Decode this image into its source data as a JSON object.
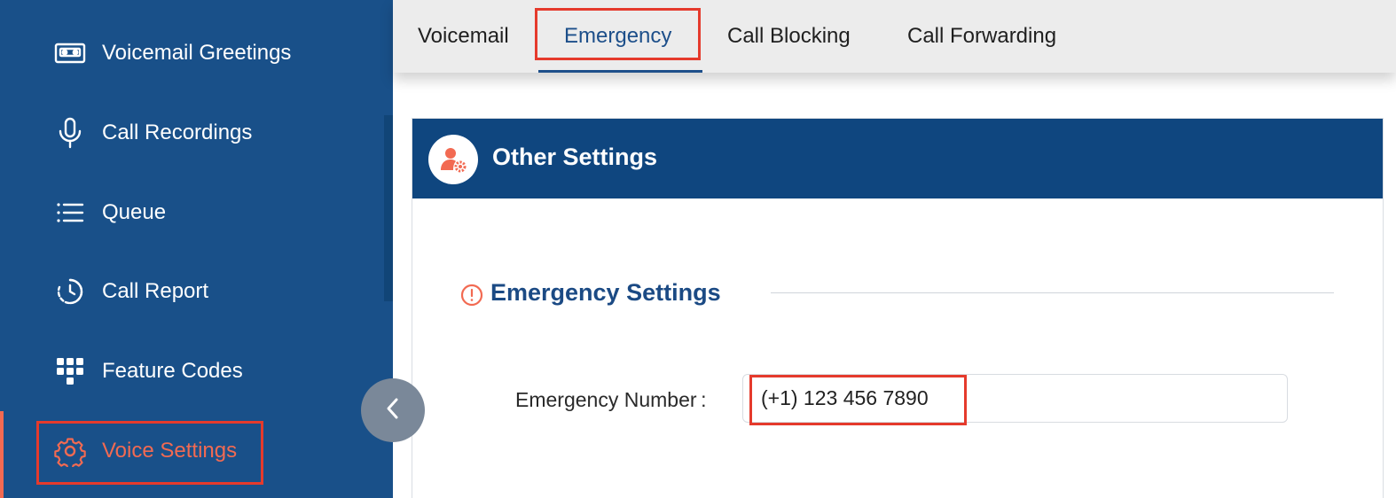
{
  "sidebar": {
    "items": [
      {
        "label": "Voicemail Greetings",
        "icon": "cassette-icon"
      },
      {
        "label": "Call Recordings",
        "icon": "microphone-icon"
      },
      {
        "label": "Queue",
        "icon": "list-icon"
      },
      {
        "label": "Call Report",
        "icon": "clock-history-icon"
      },
      {
        "label": "Feature Codes",
        "icon": "keypad-icon"
      },
      {
        "label": "Voice Settings",
        "icon": "gear-icon",
        "active": true
      }
    ]
  },
  "tabs": [
    {
      "label": "Voicemail"
    },
    {
      "label": "Emergency",
      "active": true
    },
    {
      "label": "Call Blocking"
    },
    {
      "label": "Call Forwarding"
    }
  ],
  "card": {
    "title": "Other Settings",
    "icon": "user-settings-icon"
  },
  "section": {
    "title": "Emergency Settings",
    "icon": "alert-circle-icon"
  },
  "emergency_number": {
    "label": "Emergency Number :",
    "value": "(+1) 123 456 7890"
  },
  "colors": {
    "sidebar_bg": "#195089",
    "header_bg": "#0f467f",
    "accent": "#f26a52",
    "highlight": "#e53a2c",
    "tab_active": "#1d4f8a"
  }
}
